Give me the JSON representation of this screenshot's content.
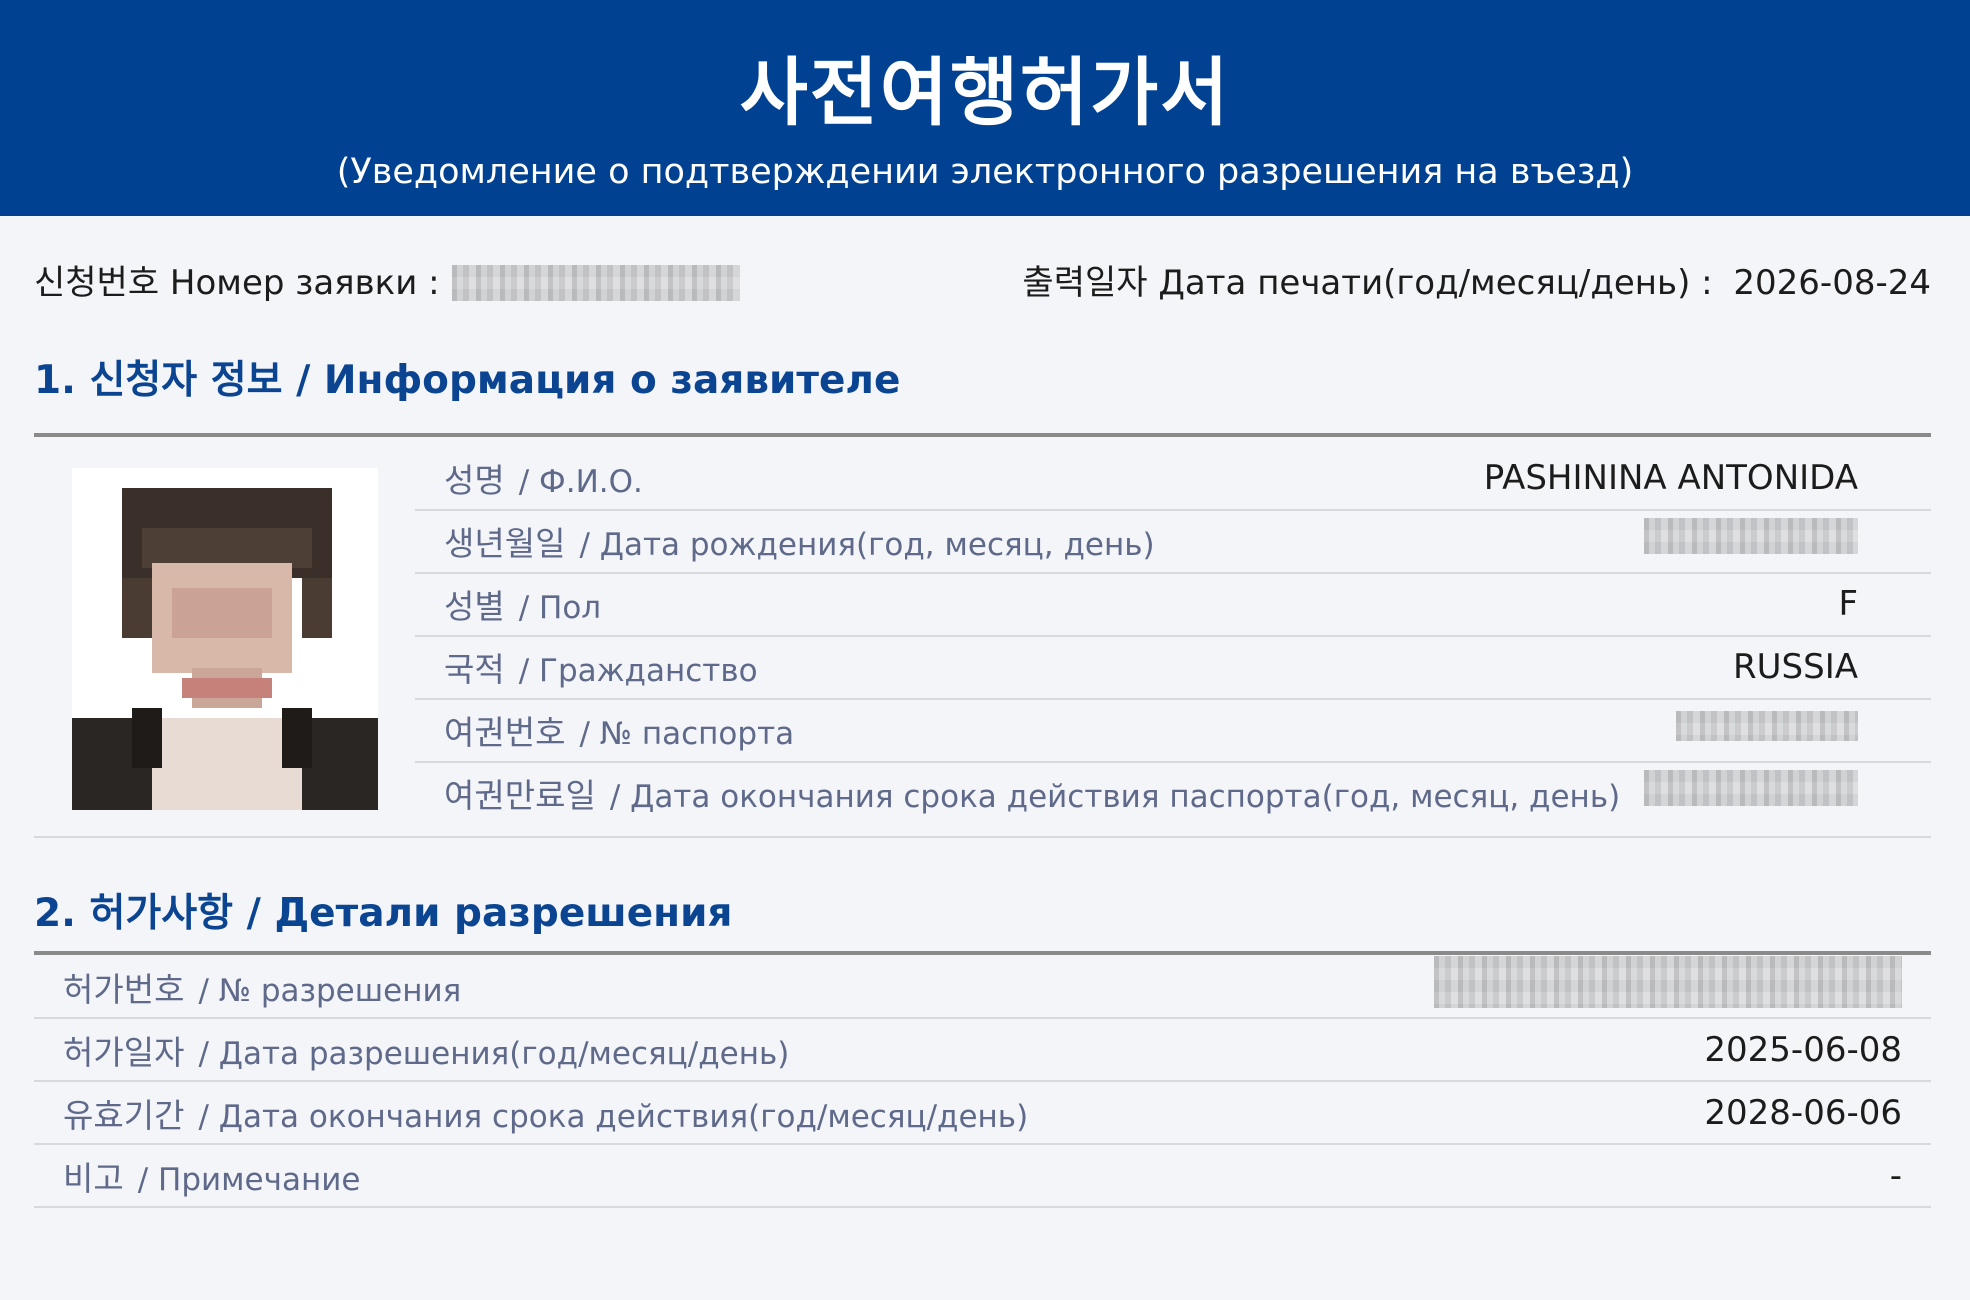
{
  "header": {
    "title": "사전여행허가서",
    "subtitle": "(Уведомление о подтверждении электронного разрешения на въезд)"
  },
  "meta": {
    "application_label": "신청번호 Номер заявки :",
    "print_date_label": "출력일자 Дата печати(год/месяц/день) :",
    "print_date_value": "2026-08-24"
  },
  "section1": {
    "title": "1. 신청자 정보 / Информация о заявителе",
    "rows": [
      {
        "ko": "성명",
        "ru": "/ Ф.И.О.",
        "value": "PASHININA ANTONIDA"
      },
      {
        "ko": "생년월일",
        "ru": "/ Дата рождения(год, месяц, день)",
        "value": ""
      },
      {
        "ko": "성별",
        "ru": "/ Пол",
        "value": "F"
      },
      {
        "ko": "국적",
        "ru": "/ Гражданство",
        "value": "RUSSIA"
      },
      {
        "ko": "여권번호",
        "ru": "/ № паспорта",
        "value": ""
      },
      {
        "ko": "여권만료일",
        "ru": "/ Дата окончания срока действия паспорта(год, месяц, день)",
        "value": ""
      }
    ]
  },
  "section2": {
    "title": "2. 허가사항 / Детали разрешения",
    "rows": [
      {
        "ko": "허가번호",
        "ru": "/ № разрешения",
        "value": ""
      },
      {
        "ko": "허가일자",
        "ru": "/ Дата разрешения(год/месяц/день)",
        "value": "2025-06-08"
      },
      {
        "ko": "유효기간",
        "ru": "/ Дата окончания срока действия(год/месяц/день)",
        "value": "2028-06-06"
      },
      {
        "ko": "비고",
        "ru": "/ Примечание",
        "value": "-"
      }
    ]
  },
  "colors": {
    "header_bg": "#004192",
    "section_title": "#0b4592",
    "label_text": "#5f6a8a",
    "page_bg": "#f4f5f9"
  }
}
